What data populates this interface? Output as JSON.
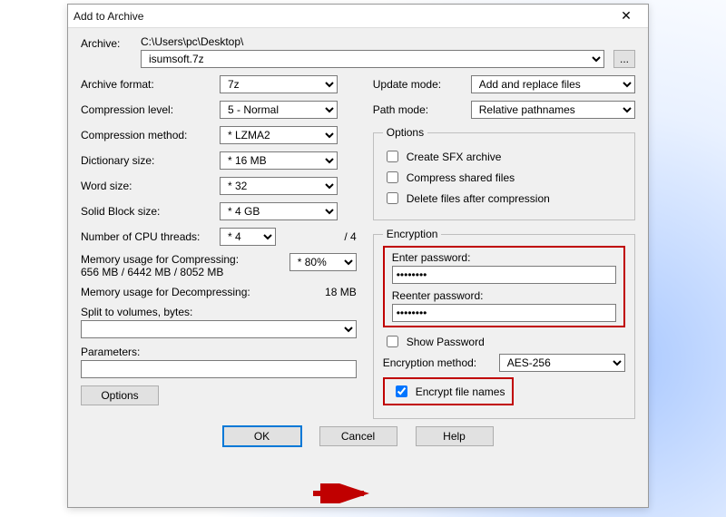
{
  "window": {
    "title": "Add to Archive"
  },
  "archive": {
    "label": "Archive:",
    "path": "C:\\Users\\pc\\Desktop\\",
    "name": "isumsoft.7z",
    "browse": "..."
  },
  "left": {
    "format": {
      "label": "Archive format:",
      "value": "7z"
    },
    "level": {
      "label": "Compression level:",
      "value": "5 - Normal"
    },
    "method": {
      "label": "Compression method:",
      "value": "* LZMA2"
    },
    "dict": {
      "label": "Dictionary size:",
      "value": "* 16 MB"
    },
    "word": {
      "label": "Word size:",
      "value": "* 32"
    },
    "block": {
      "label": "Solid Block size:",
      "value": "* 4 GB"
    },
    "threads": {
      "label": "Number of CPU threads:",
      "value": "* 4",
      "max": "/  4"
    },
    "mem_comp": {
      "label": "Memory usage for Compressing:",
      "detail": "656 MB / 6442 MB / 8052 MB",
      "value": "* 80%"
    },
    "mem_decomp": {
      "label": "Memory usage for Decompressing:",
      "value": "18 MB"
    },
    "split": {
      "label": "Split to volumes, bytes:"
    },
    "params": {
      "label": "Parameters:"
    },
    "options_btn": "Options"
  },
  "right": {
    "update": {
      "label": "Update mode:",
      "value": "Add and replace files"
    },
    "path": {
      "label": "Path mode:",
      "value": "Relative pathnames"
    },
    "options_legend": "Options",
    "opt_sfx": "Create SFX archive",
    "opt_shared": "Compress shared files",
    "opt_delete": "Delete files after compression",
    "enc_legend": "Encryption",
    "enter_pw": "Enter password:",
    "reenter_pw": "Reenter password:",
    "pw_value": "********",
    "show_pw": "Show Password",
    "enc_method": {
      "label": "Encryption method:",
      "value": "AES-256"
    },
    "enc_names": "Encrypt file names"
  },
  "buttons": {
    "ok": "OK",
    "cancel": "Cancel",
    "help": "Help"
  }
}
